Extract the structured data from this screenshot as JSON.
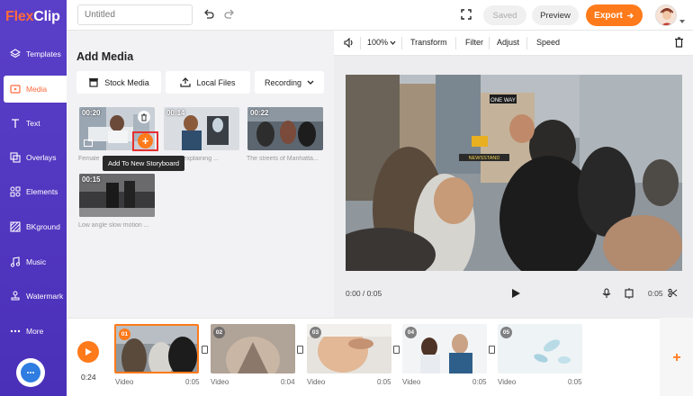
{
  "app": {
    "logo_text_a": "Flex",
    "logo_text_b": "Clip"
  },
  "sidebar": {
    "items": [
      {
        "label": "Templates",
        "icon": "layers-icon"
      },
      {
        "label": "Media",
        "icon": "media-icon",
        "active": true
      },
      {
        "label": "Text",
        "icon": "text-icon"
      },
      {
        "label": "Overlays",
        "icon": "overlays-icon"
      },
      {
        "label": "Elements",
        "icon": "elements-icon"
      },
      {
        "label": "BKground",
        "icon": "background-icon"
      },
      {
        "label": "Music",
        "icon": "music-icon"
      },
      {
        "label": "Watermark",
        "icon": "watermark-icon"
      },
      {
        "label": "More",
        "icon": "more-icon"
      }
    ]
  },
  "topbar": {
    "title_placeholder": "Untitled",
    "saved_label": "Saved",
    "preview_label": "Preview",
    "export_label": "Export"
  },
  "media_panel": {
    "title": "Add Media",
    "stock_label": "Stock Media",
    "local_label": "Local Files",
    "recording_label": "Recording",
    "tooltip": "Add To New Storyboard",
    "items": [
      {
        "duration": "00:20",
        "caption": "Female"
      },
      {
        "duration": "00:14",
        "caption": "Doctor explaining ..."
      },
      {
        "duration": "00:22",
        "caption": "The streets of Manhatta..."
      },
      {
        "duration": "00:15",
        "caption": "Low angle slow motion ..."
      }
    ]
  },
  "editor_toolbar": {
    "zoom": "100%",
    "transform": "Transform",
    "filter": "Filter",
    "adjust": "Adjust",
    "speed": "Speed"
  },
  "player": {
    "current_time": "0:00 / 0:05",
    "duration": "0:05",
    "sign_one_way": "ONE WAY",
    "sign_newsstand": "NEWSSTAND"
  },
  "timeline": {
    "total_time": "0:24",
    "clips": [
      {
        "num": "01",
        "label": "Video",
        "duration": "0:05",
        "selected": true
      },
      {
        "num": "02",
        "label": "Video",
        "duration": "0:04"
      },
      {
        "num": "03",
        "label": "Video",
        "duration": "0:05"
      },
      {
        "num": "04",
        "label": "Video",
        "duration": "0:05"
      },
      {
        "num": "05",
        "label": "Video",
        "duration": "0:05"
      }
    ]
  },
  "colors": {
    "accent": "#ff7a1a",
    "sidebar": "#5a3fc8"
  }
}
